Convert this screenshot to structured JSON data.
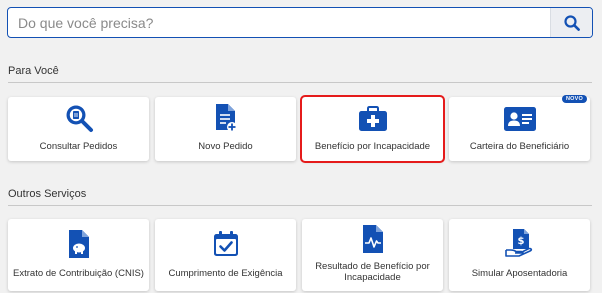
{
  "search": {
    "placeholder": "Do que você precisa?"
  },
  "sections": [
    {
      "title": "Para Você",
      "cards": [
        {
          "label": "Consultar Pedidos",
          "icon": "search-document-icon"
        },
        {
          "label": "Novo Pedido",
          "icon": "new-document-icon"
        },
        {
          "label": "Benefício por Incapacidade",
          "icon": "medical-kit-icon",
          "selected": true
        },
        {
          "label": "Carteira do Beneficiário",
          "icon": "id-card-icon",
          "badge": "NOVO"
        }
      ]
    },
    {
      "title": "Outros Serviços",
      "cards": [
        {
          "label": "Extrato de Contribuição (CNIS)",
          "icon": "savings-document-icon"
        },
        {
          "label": "Cumprimento de Exigência",
          "icon": "calendar-check-icon"
        },
        {
          "label": "Resultado de Benefício por Incapacidade",
          "icon": "pulse-document-icon"
        },
        {
          "label": "Simular Aposentadoria",
          "icon": "money-hand-icon"
        }
      ]
    }
  ],
  "colors": {
    "accent": "#1351b4",
    "highlight": "#e51b1b"
  }
}
